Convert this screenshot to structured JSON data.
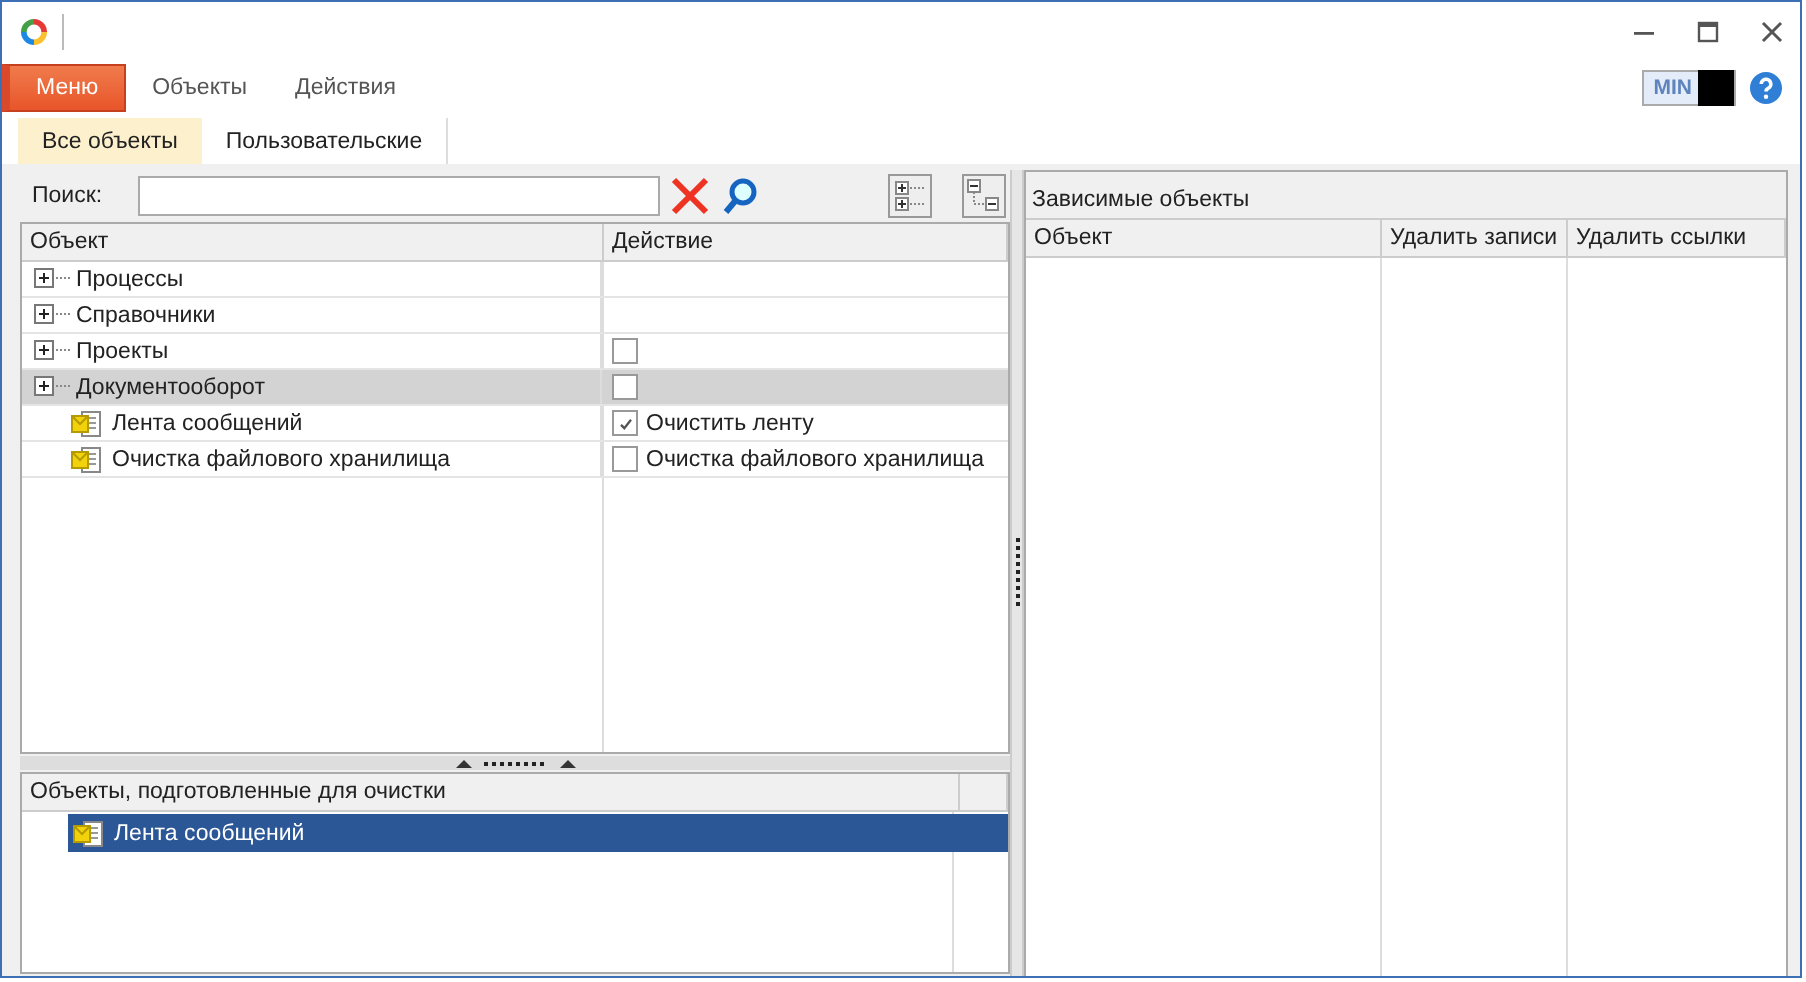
{
  "menu": [
    {
      "label": "Меню",
      "selected": true
    },
    {
      "label": "Объекты",
      "selected": false
    },
    {
      "label": "Действия",
      "selected": false
    }
  ],
  "mode_toggle": {
    "label": "MIN"
  },
  "tabs": [
    {
      "label": "Все объекты",
      "selected": true
    },
    {
      "label": "Пользовательские",
      "selected": false
    }
  ],
  "search": {
    "label": "Поиск:"
  },
  "tree": {
    "columns": [
      "Объект",
      "Действие"
    ],
    "items": [
      {
        "name": "Процессы",
        "selected": false,
        "expanded": false
      },
      {
        "name": "Справочники",
        "selected": false,
        "expanded": false
      },
      {
        "name": "Проекты",
        "selected": false,
        "expanded": false,
        "action": {
          "checked": false
        }
      },
      {
        "name": "Документооборот",
        "selected": true,
        "expanded": false,
        "action": {
          "checked": false
        },
        "children": [
          {
            "name": "Лента сообщений",
            "selected": false,
            "action": {
              "checked": true,
              "label": "Очистить ленту"
            }
          },
          {
            "name": "Очистка файлового хранилища",
            "selected": false,
            "action": {
              "checked": false,
              "label": "Очистка файлового хранилища"
            }
          }
        ]
      }
    ]
  },
  "prepared": {
    "title": "Объекты, подготовленные для очистки",
    "rows": [
      {
        "name": "Лента сообщений",
        "selected": true
      }
    ]
  },
  "dependent": {
    "title": "Зависимые объекты",
    "columns": [
      "Объект",
      "Удалить записи",
      "Удалить ссылки"
    ]
  }
}
